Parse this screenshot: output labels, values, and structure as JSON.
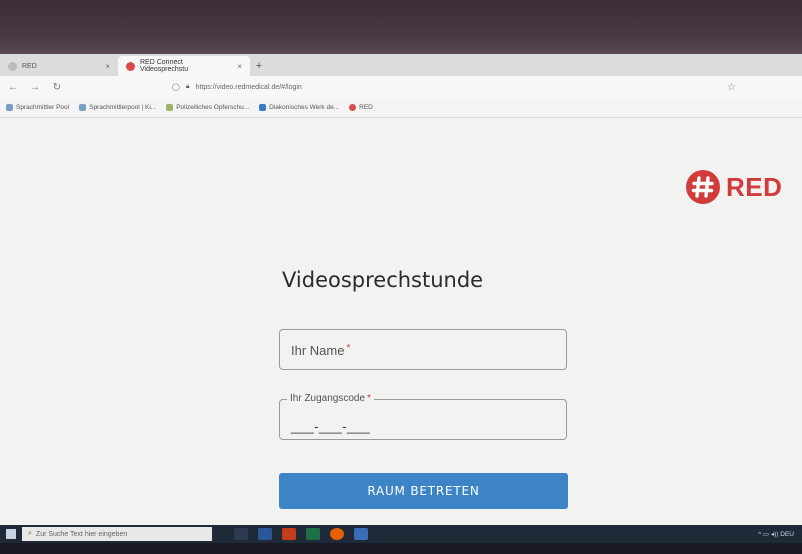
{
  "browser": {
    "tabs": [
      {
        "label": "RED",
        "close": "×"
      },
      {
        "label": "RED Connect Videosprechstu",
        "close": "×"
      }
    ],
    "new_tab": "+",
    "url": "https://video.redmedical.de/#/login",
    "bookmarks": [
      "Sprachmittler Pool",
      "Sprachmittlerpool | Ki...",
      "Polizeiliches Opferschu...",
      "Diakonisches Werk de...",
      "RED"
    ]
  },
  "brand": {
    "logo_text": "RED",
    "color": "#d23b3b"
  },
  "login": {
    "title": "Videosprechstunde",
    "name_placeholder": "Ihr Name",
    "code_label": "Ihr Zugangscode",
    "code_value": "___-___-___",
    "required_mark": "*",
    "submit_label": "RAUM BETRETEN",
    "submit_color": "#3d84c6"
  },
  "taskbar": {
    "search_placeholder": "Zur Suche Text hier eingeben",
    "tray_text": "DEU"
  }
}
